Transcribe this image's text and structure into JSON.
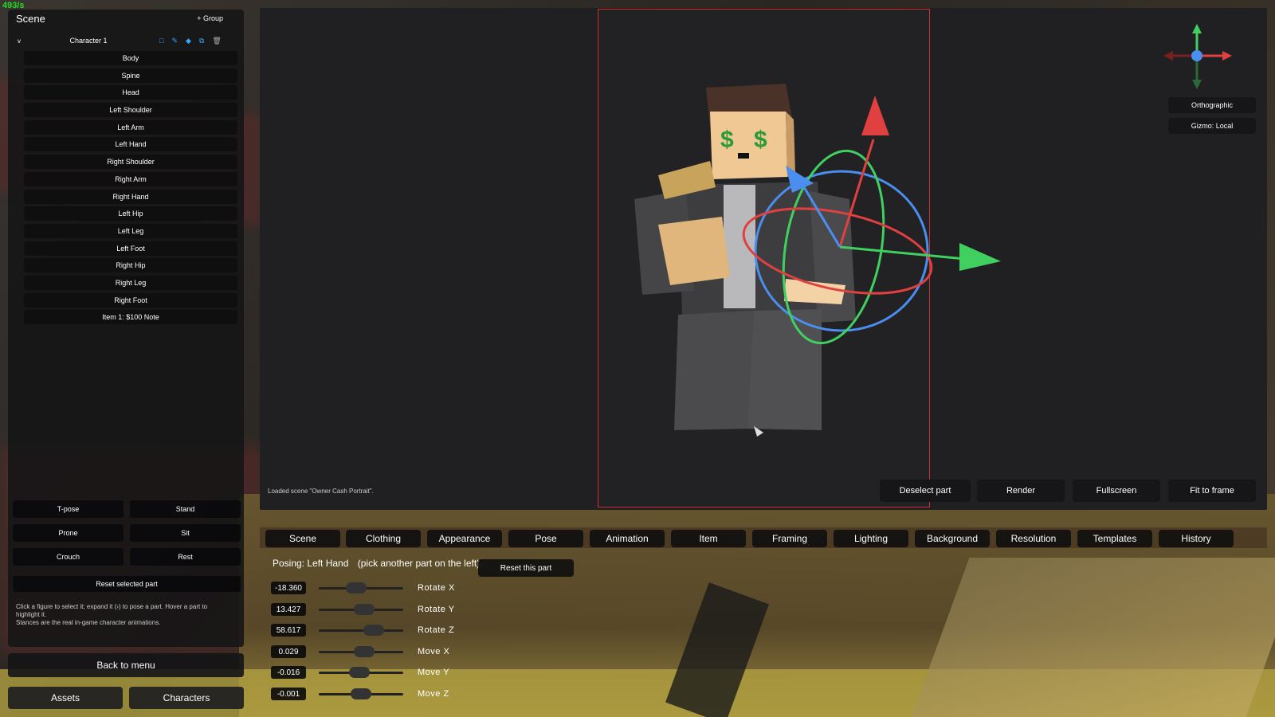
{
  "fps": "493/s",
  "left_panel": {
    "title": "Scene",
    "group_button": "+ Group",
    "character": {
      "chevron": "v",
      "name": "Character 1"
    },
    "parts": [
      "Body",
      "Spine",
      "Head",
      "Left Shoulder",
      "Left Arm",
      "Left Hand",
      "Right Shoulder",
      "Right Arm",
      "Right Hand",
      "Left Hip",
      "Left Leg",
      "Left Foot",
      "Right Hip",
      "Right Leg",
      "Right Foot",
      "Item 1: $100 Note"
    ],
    "stances": [
      "T-pose",
      "Stand",
      "Prone",
      "Sit",
      "Crouch",
      "Rest"
    ],
    "reset_selected": "Reset selected part",
    "help_lines": [
      "Click a figure to select it; expand it (›) to pose a part. Hover a part to highlight it.",
      "Stances are the real in-game character animations."
    ]
  },
  "back_to_menu": "Back to menu",
  "bottom_tabs": [
    "Assets",
    "Characters"
  ],
  "viewport": {
    "status": "Loaded scene \"Owner Cash Portrait\".",
    "buttons": [
      "Deselect part",
      "Render",
      "Fullscreen",
      "Fit to frame"
    ],
    "side_buttons": [
      "Orthographic",
      "Gizmo: Local"
    ]
  },
  "tool_tabs": [
    "Scene",
    "Clothing",
    "Appearance",
    "Pose",
    "Animation",
    "Item",
    "Framing",
    "Lighting",
    "Background",
    "Resolution",
    "Templates",
    "History"
  ],
  "posing": {
    "label": "Posing: Left Hand",
    "hint": "(pick another part on the left)",
    "reset_button": "Reset this part"
  },
  "sliders": [
    {
      "value": "-18.360",
      "label": "Rotate X"
    },
    {
      "value": "13.427",
      "label": "Rotate Y"
    },
    {
      "value": "58.617",
      "label": "Rotate Z"
    },
    {
      "value": "0.029",
      "label": "Move X"
    },
    {
      "value": "-0.016",
      "label": "Move Y"
    },
    {
      "value": "-0.001",
      "label": "Move Z"
    }
  ],
  "colors": {
    "accent_red": "#c83030",
    "fps_green": "#22dd22",
    "gizmo_red": "#e04040",
    "gizmo_green": "#40d060",
    "gizmo_blue": "#4a8ef0"
  }
}
